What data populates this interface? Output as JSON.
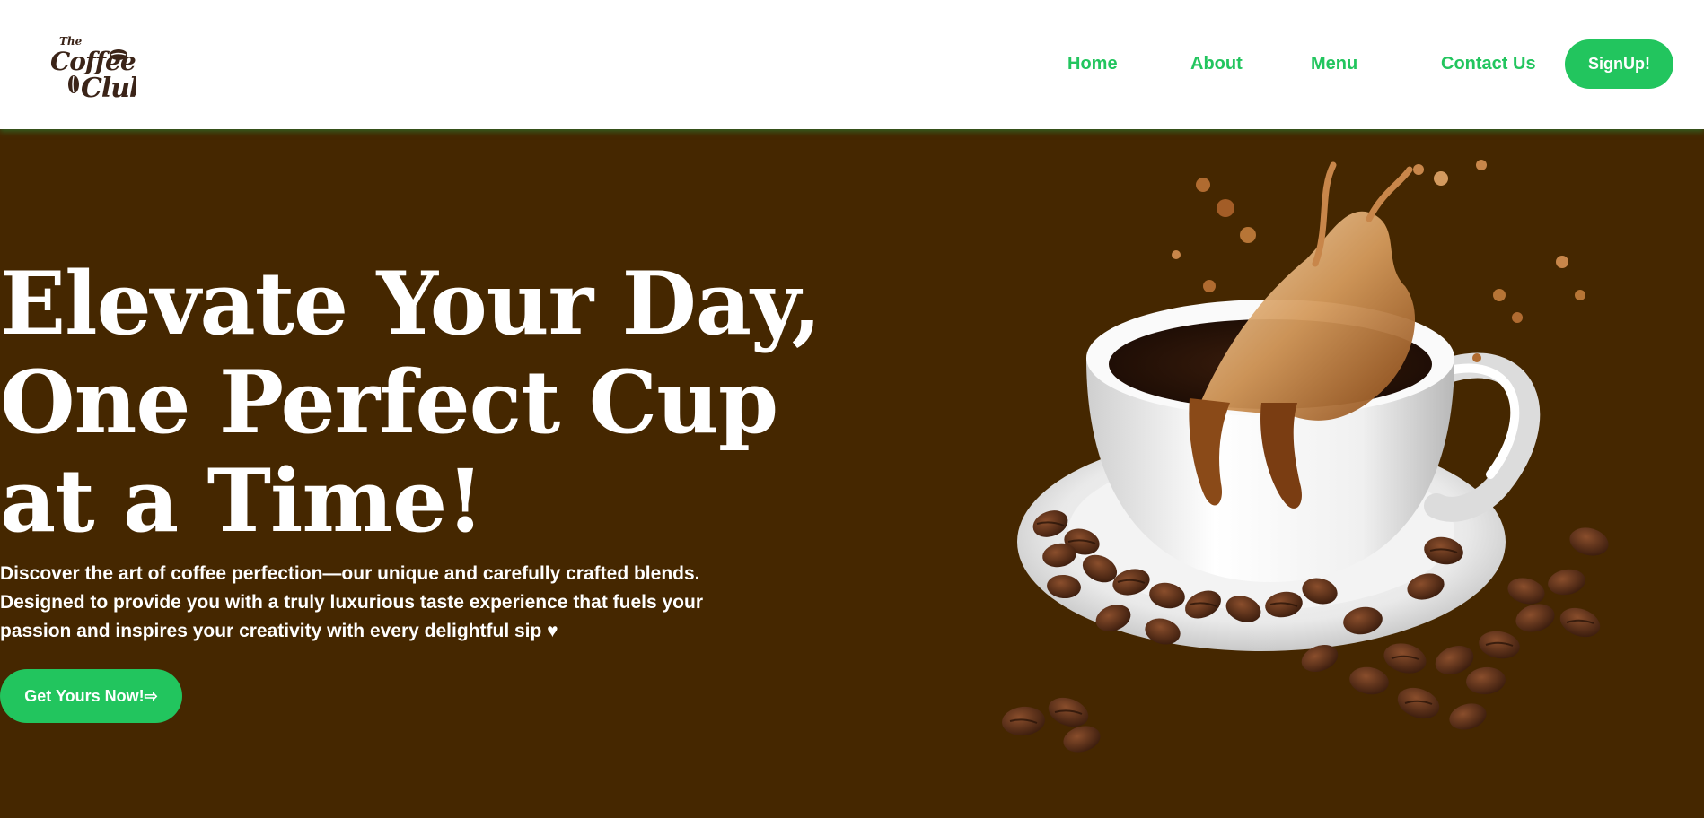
{
  "header": {
    "logo": {
      "line1": "The",
      "line2": "Coffee",
      "line3": "Club",
      "color": "#3b2418"
    },
    "nav": {
      "home": "Home",
      "about": "About",
      "menu": "Menu",
      "contact": "Contact Us",
      "signup": "SignUp!"
    }
  },
  "hero": {
    "headline": {
      "line1": "Elevate Your Day,",
      "line2": "One Perfect Cup",
      "line3": "at a Time!"
    },
    "subtext": {
      "line1": "Discover the art of coffee perfection—our unique and carefully crafted blends.",
      "line2": "Designed to provide you with a truly luxurious taste experience that fuels your",
      "line3": "passion and inspires your creativity with every delightful sip ♥"
    },
    "cta_label": "Get Yours Now!⇨",
    "image": "coffee-cup-splash-with-beans"
  },
  "colors": {
    "accent": "#22c55e",
    "hero_background": "#452700",
    "header_background": "#ffffff",
    "text_light": "#ffffff"
  }
}
